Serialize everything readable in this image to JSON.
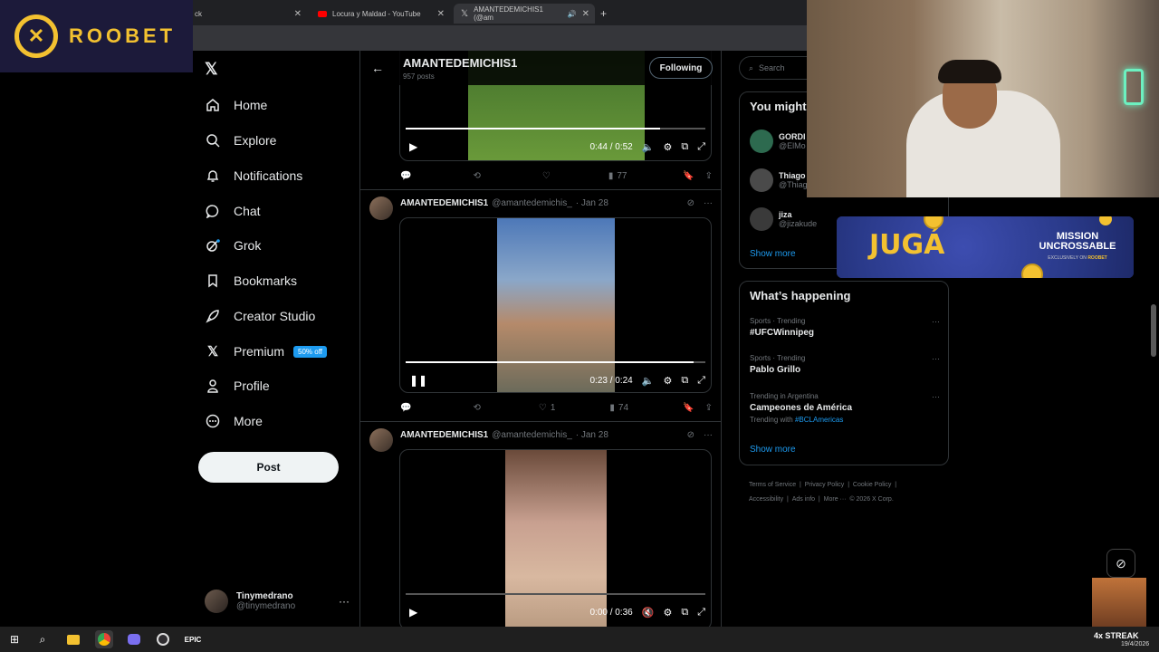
{
  "browser": {
    "tabs": [
      {
        "label": "ck"
      },
      {
        "label": "Locura y Maldad - YouTube"
      },
      {
        "label": "AMANTEDEMICHIS1 (@am"
      }
    ],
    "new_tab": "+"
  },
  "roobet": {
    "brand": "ROOBET"
  },
  "nav": {
    "items": [
      {
        "label": "Home",
        "icon": "home-icon"
      },
      {
        "label": "Explore",
        "icon": "search-icon"
      },
      {
        "label": "Notifications",
        "icon": "bell-icon"
      },
      {
        "label": "Chat",
        "icon": "chat-icon"
      },
      {
        "label": "Grok",
        "icon": "grok-icon"
      },
      {
        "label": "Bookmarks",
        "icon": "bookmark-icon"
      },
      {
        "label": "Creator Studio",
        "icon": "rocket-icon"
      },
      {
        "label": "Premium",
        "icon": "x-logo-icon"
      },
      {
        "label": "Profile",
        "icon": "person-icon"
      },
      {
        "label": "More",
        "icon": "more-circle-icon"
      }
    ],
    "premium_badge": "50% off",
    "post_label": "Post",
    "account": {
      "name": "Tinymedrano",
      "handle": "@tinymedrano"
    }
  },
  "profile": {
    "name": "AMANTEDEMICHIS1",
    "posts": "957 posts",
    "follow_label": "Following"
  },
  "tweets": [
    {
      "video_time": "0:44 / 0:52",
      "progress": 0.85,
      "views": "77",
      "likes": ""
    },
    {
      "author": "AMANTEDEMICHIS1",
      "handle": "@amantedemichis_",
      "date": "· Jan 28",
      "video_time": "0:23 / 0:24",
      "progress": 0.96,
      "likes": "1",
      "views": "74"
    },
    {
      "author": "AMANTEDEMICHIS1",
      "handle": "@amantedemichis_",
      "date": "· Jan 28",
      "video_time": "0:00 / 0:36",
      "progress": 0.0
    }
  ],
  "right": {
    "search_placeholder": "Search",
    "who_title": "You might",
    "who": [
      {
        "name": "GORDI",
        "handle": "@ElMo"
      },
      {
        "name": "Thiago",
        "handle": "@Thiag"
      },
      {
        "name": "jiza",
        "handle": "@jizakude"
      }
    ],
    "show_more": "Show more",
    "happening_title": "What’s happening",
    "trends": [
      {
        "meta": "Sports · Trending",
        "title": "#UFCWinnipeg",
        "extra": ""
      },
      {
        "meta": "Sports · Trending",
        "title": "Pablo Grillo",
        "extra": ""
      },
      {
        "meta": "Trending in Argentina",
        "title": "Campeones de América",
        "extra_prefix": "Trending with",
        "extra": "#BCLAmericas"
      }
    ],
    "show_more_2": "Show more",
    "footer": [
      "Terms of Service",
      "|",
      "Privacy Policy",
      "|",
      "Cookie Policy",
      "|",
      "Accessibility",
      "|",
      "Ads info",
      "|",
      "More ···",
      "© 2026 X Corp."
    ]
  },
  "banner": {
    "title": "JUGÁ",
    "line1": "MISSION",
    "line2": "UNCROSSABLE",
    "sub": "EXCLUSIVELY ON",
    "brand": "ROOBET"
  },
  "taskbar": {
    "streak": "4x STREAK",
    "date": "19/4/2026"
  }
}
